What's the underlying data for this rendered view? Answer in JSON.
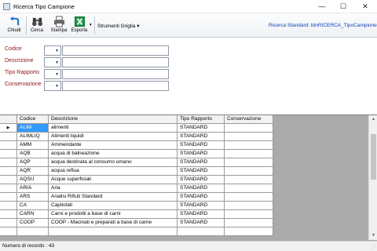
{
  "window": {
    "title": "Ricerca Tipo Campione",
    "min_glyph": "—",
    "max_glyph": "☐",
    "close_glyph": "✕"
  },
  "toolbar": {
    "buttons": [
      {
        "label": "Chiudi",
        "icon": "back-arrow-icon"
      },
      {
        "label": "Cerca",
        "icon": "binoculars-icon"
      },
      {
        "label": "Stampa",
        "icon": "printer-icon"
      },
      {
        "label": "Esporta",
        "icon": "excel-icon"
      }
    ],
    "dropdown_glyph": "▾",
    "grid_tools_label": "Strumenti Griglia ▾",
    "standard_search": "Ricerca Standard: btnRICERCA_TipoCampione"
  },
  "filters": [
    {
      "label": "Codice",
      "operator": "",
      "value": ""
    },
    {
      "label": "Descrizione",
      "operator": "",
      "value": ""
    },
    {
      "label": "Tipo Rapporto",
      "operator": "",
      "value": ""
    },
    {
      "label": "Conservazione",
      "operator": "",
      "value": ""
    }
  ],
  "grid": {
    "columns": [
      "",
      "Codice",
      "Descrizione",
      "Tipo Rapporto",
      "Conservazione"
    ],
    "current_row_marker": "▶",
    "rows": [
      [
        "ALIM",
        "alimenti",
        "STANDARD",
        ""
      ],
      [
        "ALIMLIQ",
        "Alimenti liquidi",
        "STANDARD",
        ""
      ],
      [
        "AMM",
        "Ammendante",
        "STANDARD",
        ""
      ],
      [
        "AQB",
        "acqua di balneazione",
        "STANDARD",
        ""
      ],
      [
        "AQP",
        "acqua destinata al consumo umano",
        "STANDARD",
        ""
      ],
      [
        "AQR",
        "acqua reflua",
        "STANDARD",
        ""
      ],
      [
        "AQSU",
        "Acque superficiali",
        "STANDARD",
        ""
      ],
      [
        "ARIA",
        "Aria",
        "STANDARD",
        ""
      ],
      [
        "ARS",
        "Analisi Rifiuti Standard",
        "STANDARD",
        ""
      ],
      [
        "CA",
        "Capitolati",
        "STANDARD",
        ""
      ],
      [
        "CARN",
        "Carni e prodotti a base di carni",
        "STANDARD",
        ""
      ],
      [
        "COOP",
        "COOP - Macinati e preparati a base di carne",
        "STANDARD",
        ""
      ],
      [
        "",
        "",
        "",
        ""
      ]
    ]
  },
  "status": {
    "records_text": "Numero di records : 43"
  },
  "colors": {
    "label_red": "#8b1313",
    "link_blue": "#0b3fb8",
    "selection": "#3399ff"
  }
}
